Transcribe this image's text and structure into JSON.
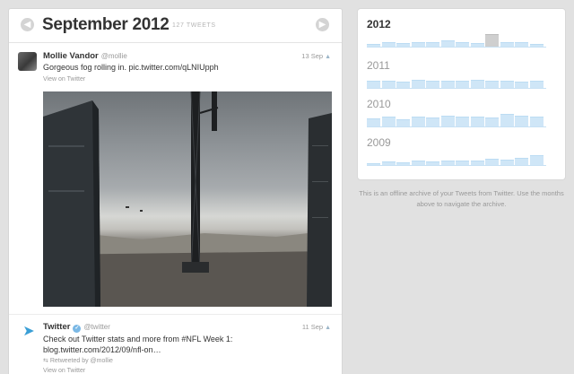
{
  "header": {
    "month": "September 2012",
    "count": "127 TWEETS",
    "prev_icon": "chevron-left",
    "next_icon": "chevron-right"
  },
  "tweets": [
    {
      "name": "Mollie Vandor",
      "handle": "@mollie",
      "date": "13 Sep",
      "text": "Gorgeous fog rolling in. pic.twitter.com/qLNIUpph",
      "view": "View on Twitter"
    },
    {
      "name": "Twitter",
      "handle": "@twitter",
      "date": "11 Sep",
      "text": "Check out Twitter stats and more from #NFL Week 1: blog.twitter.com/2012/09/nfl-on…",
      "retweeted": "Retweeted by @mollie",
      "view": "View on Twitter"
    }
  ],
  "archive": {
    "years": [
      {
        "label": "2012",
        "active": true,
        "levels": [
          0.2,
          0.3,
          0.25,
          0.35,
          0.3,
          0.45,
          0.3,
          0.25,
          0.9,
          0.3,
          0.35,
          0.2
        ],
        "selected_month": 9
      },
      {
        "label": "2011",
        "active": false,
        "levels": [
          0.5,
          0.55,
          0.45,
          0.6,
          0.5,
          0.55,
          0.5,
          0.6,
          0.55,
          0.5,
          0.45,
          0.55
        ]
      },
      {
        "label": "2010",
        "active": false,
        "levels": [
          0.6,
          0.75,
          0.55,
          0.7,
          0.65,
          0.8,
          0.7,
          0.75,
          0.65,
          0.9,
          0.8,
          0.7
        ]
      },
      {
        "label": "2009",
        "active": false,
        "levels": [
          0.1,
          0.25,
          0.2,
          0.3,
          0.25,
          0.3,
          0.35,
          0.3,
          0.45,
          0.4,
          0.5,
          0.75
        ]
      }
    ],
    "colors": {
      "bar": "#cfe6f7",
      "selected": "#cfcfcf",
      "link_bird": "#3a9fd6"
    }
  },
  "note": "This is an offline archive of your Tweets from Twitter. Use the months above to navigate the archive."
}
